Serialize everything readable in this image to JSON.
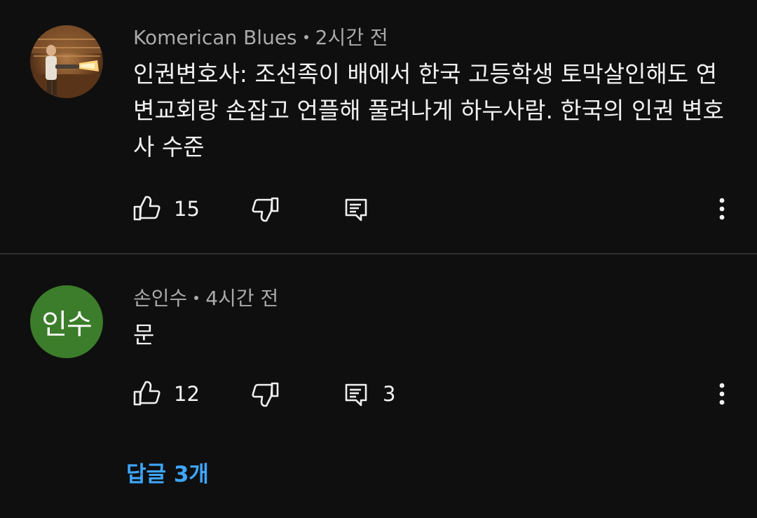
{
  "colors": {
    "background": "#0f0f0f",
    "text_primary": "#f1f1f1",
    "text_secondary": "#aaaaaa",
    "link_blue": "#3ea6ff",
    "avatar_green": "#3b7d2a"
  },
  "comments": [
    {
      "author": "Komerican Blues",
      "time": "2시간 전",
      "text": "인권변호사: 조선족이 배에서 한국 고등학생 토막살인해도 연변교회랑 손잡고 언플해 풀려나게 하누사람. 한국의 인권 변호사 수준",
      "likes": "15",
      "reply_count": "",
      "avatar_type": "photo"
    },
    {
      "author": "손인수",
      "time": "4시간 전",
      "text": "문",
      "likes": "12",
      "reply_count": "3",
      "avatar_letters": "인수",
      "replies_link": "답글 3개"
    }
  ],
  "icons": {
    "like": "thumbs-up-icon",
    "dislike": "thumbs-down-icon",
    "reply": "comment-reply-icon",
    "more": "more-vertical-icon"
  }
}
